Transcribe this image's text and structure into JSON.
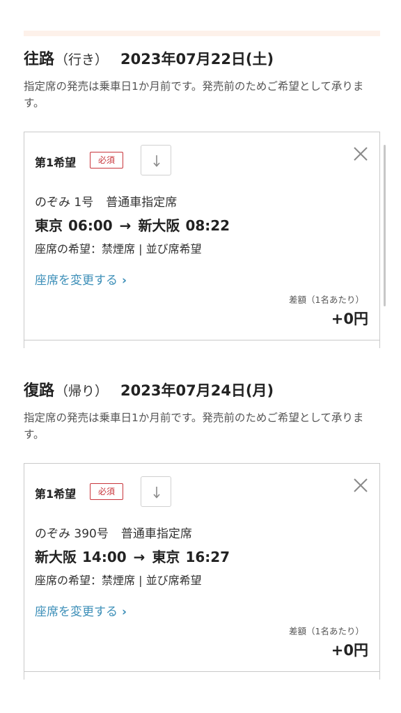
{
  "outbound": {
    "title": "往路",
    "paren": "（行き）",
    "date": "2023年07月22日(土)",
    "note": "指定席の発売は乗車日1か月前です。発売前のためご希望として承ります。",
    "card": {
      "preference_label": "第1希望",
      "required_badge": "必須",
      "train_name": "のぞみ 1号",
      "car_class": "普通車指定席",
      "from": "東京",
      "dep_time": "06:00",
      "arrow": "→",
      "to": "新大阪",
      "arr_time": "08:22",
      "seat_preference": "座席の希望：禁煙席 | 並び席希望",
      "change_link": "座席を変更する",
      "change_chevron": "›",
      "diff_label": "差額（1名あたり）",
      "diff_amount": "+0円"
    }
  },
  "return": {
    "title": "復路",
    "paren": "（帰り）",
    "date": "2023年07月24日(月)",
    "note": "指定席の発売は乗車日1か月前です。発売前のためご希望として承ります。",
    "card": {
      "preference_label": "第1希望",
      "required_badge": "必須",
      "train_name": "のぞみ 390号",
      "car_class": "普通車指定席",
      "from": "新大阪",
      "dep_time": "14:00",
      "arrow": "→",
      "to": "東京",
      "arr_time": "16:27",
      "seat_preference": "座席の希望：禁煙席 | 並び席希望",
      "change_link": "座席を変更する",
      "change_chevron": "›",
      "diff_label": "差額（1名あたり）",
      "diff_amount": "+0円"
    }
  },
  "colors": {
    "link": "#3d8fb8",
    "required": "#c8353b",
    "stripe": "#fdf1ea"
  },
  "icons": {
    "down": "arrow-down-icon",
    "close": "close-icon"
  }
}
